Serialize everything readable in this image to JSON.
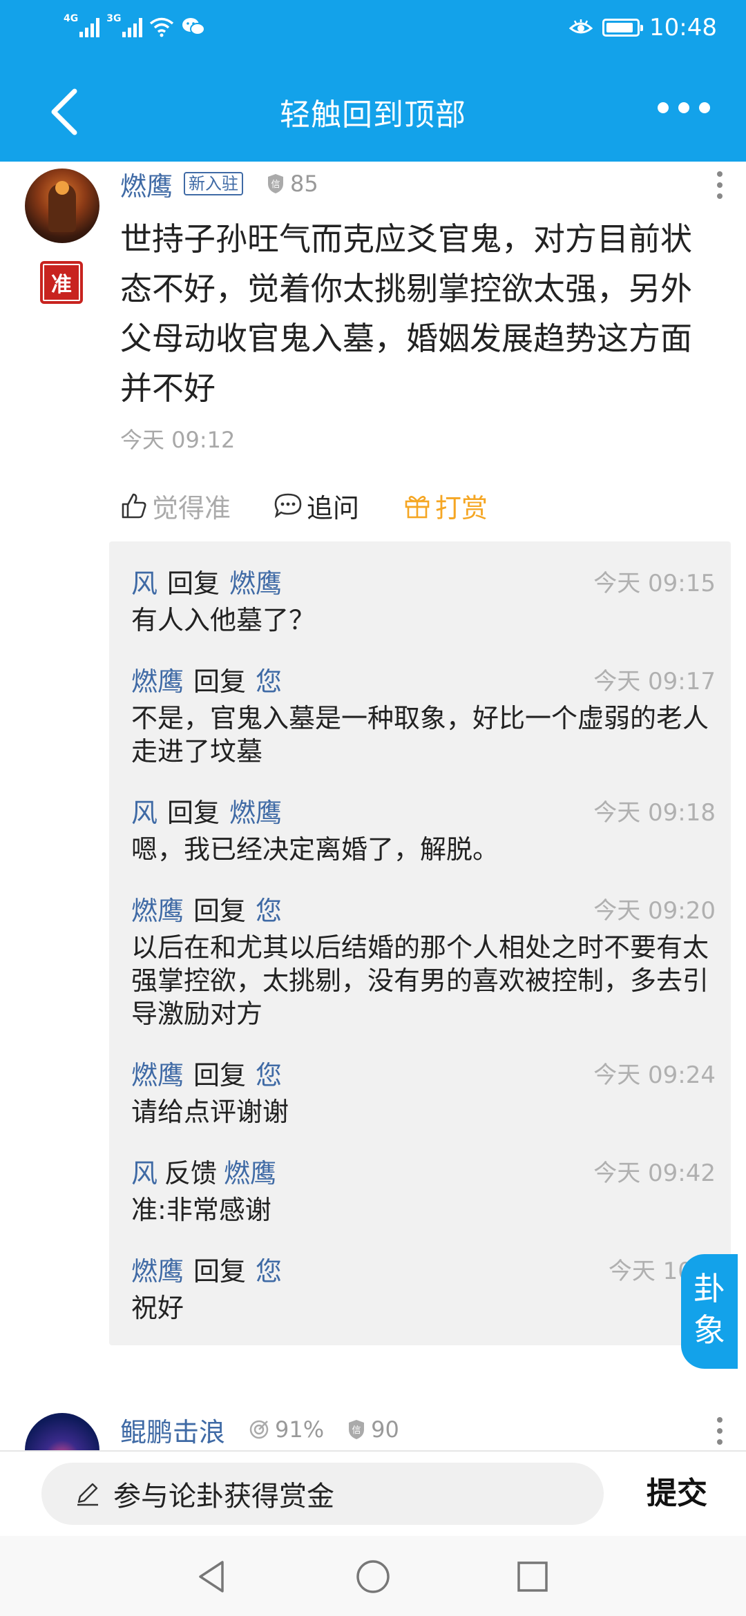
{
  "status_bar": {
    "network_1": "4G",
    "network_2": "3G",
    "time": "10:48",
    "battery_level": 0.9
  },
  "nav": {
    "title": "轻触回到顶部"
  },
  "post": {
    "username": "燃鹰",
    "badge": "新入驻",
    "trust_score": "85",
    "seal_char": "准",
    "content": "世持子孙旺气而克应爻官鬼，对方目前状态不好，觉着你太挑剔掌控欲太强，另外父母动收官鬼入墓，婚姻发展趋势这方面并不好",
    "time": "今天 09:12",
    "actions": {
      "like": "觉得准",
      "ask": "追问",
      "reward": "打赏"
    }
  },
  "replies": [
    {
      "from": "风",
      "verb": "回复",
      "to": "燃鹰",
      "time": "今天 09:15",
      "text": "有人入他墓了？"
    },
    {
      "from": "燃鹰",
      "verb": "回复",
      "to": "您",
      "time": "今天 09:17",
      "text": "不是，官鬼入墓是一种取象，好比一个虚弱的老人走进了坟墓"
    },
    {
      "from": "风",
      "verb": "回复",
      "to": "燃鹰",
      "time": "今天 09:18",
      "text": "嗯，我已经决定离婚了，解脱。"
    },
    {
      "from": "燃鹰",
      "verb": "回复",
      "to": "您",
      "time": "今天 09:20",
      "text": "以后在和尤其以后结婚的那个人相处之时不要有太强掌控欲，太挑剔，没有男的喜欢被控制，多去引导激励对方"
    },
    {
      "from": "燃鹰",
      "verb": "回复",
      "to": "您",
      "time": "今天 09:24",
      "text": "请给点评谢谢"
    },
    {
      "from": "风",
      "verb": "反馈",
      "to": "燃鹰",
      "time": "今天 09:42",
      "text": "准:非常感谢"
    },
    {
      "from": "燃鹰",
      "verb": "回复",
      "to": "您",
      "time": "今天 10:5",
      "text": "祝好"
    }
  ],
  "gua_button": "卦象",
  "post2": {
    "username": "鲲鹏击浪",
    "accuracy": "91%",
    "trust_score": "90"
  },
  "bottom": {
    "input_placeholder": "参与论卦获得赏金",
    "submit": "提交"
  },
  "colors": {
    "primary": "#13a2ea",
    "name_blue": "#3f6aa5",
    "reward_orange": "#f5a623",
    "seal_red": "#c8231f"
  }
}
